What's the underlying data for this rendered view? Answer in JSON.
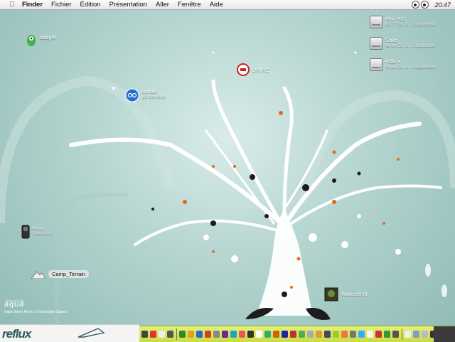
{
  "menubar": {
    "app": "Finder",
    "items": [
      "Fichier",
      "Édition",
      "Présentation",
      "Aller",
      "Fenêtre",
      "Aide"
    ],
    "clock": "20:47"
  },
  "desktop": {
    "icons": [
      {
        "name": "badger",
        "label": "badger",
        "sub": ""
      },
      {
        "name": "bordel",
        "label": "bordel",
        "sub": "13 éléments"
      },
      {
        "name": "drire",
        "label": "DRIRE",
        "sub": ""
      },
      {
        "name": "kazi",
        "label": "Kazi",
        "sub": "2 éléments"
      },
      {
        "name": "camp",
        "label": "Camp_Terrain",
        "sub": ""
      },
      {
        "name": "warcraft",
        "label": "Warcraft III",
        "sub": ""
      }
    ],
    "drives": [
      {
        "label": "Mac HD",
        "sub": "93,77 Go, 3... o disponible"
      },
      {
        "label": "Save",
        "sub": "94,64 Go, 3... o disponible"
      },
      {
        "label": "• dar •",
        "sub": "94,64 Go, 3... o disponible"
      }
    ]
  },
  "wallpaper": {
    "brand_small": "aqua",
    "credit": "Vader Berry Remix / Underwater Spawn"
  },
  "bottombar": {
    "logo": "reflux"
  },
  "colors": {
    "accent": "#e06b1e",
    "tree": "#ffffff",
    "dock": "#d6e65a"
  }
}
